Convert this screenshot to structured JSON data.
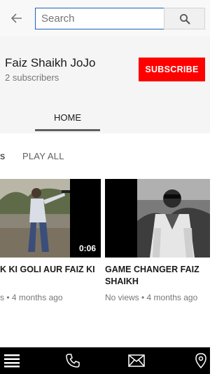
{
  "search": {
    "placeholder": "Search",
    "value": ""
  },
  "icons": {
    "back": "arrow-left-icon",
    "search": "magnifier-icon",
    "menu": "hamburger-icon",
    "phone": "phone-icon",
    "mail": "envelope-icon",
    "location": "location-pin-icon"
  },
  "channel": {
    "name": "Faiz Shaikh JoJo",
    "subscribers": "2 subscribers",
    "subscribe_label": "SUBSCRIBE"
  },
  "tabs": [
    {
      "label": "HOME",
      "selected": true
    }
  ],
  "section": {
    "title_fragment": "ls",
    "play_all_label": "PLAY ALL"
  },
  "videos": [
    {
      "title": "K KI GOLI AUR FAIZ KI",
      "meta": "s • 4 months ago",
      "duration": "0:06"
    },
    {
      "title": "GAME CHANGER FAIZ SHAIKH",
      "meta": "No views • 4 months ago",
      "duration": ""
    }
  ],
  "colors": {
    "subscribe": "#ff0000",
    "search_border": "#1c62b9",
    "bottom_bar": "#000000"
  }
}
